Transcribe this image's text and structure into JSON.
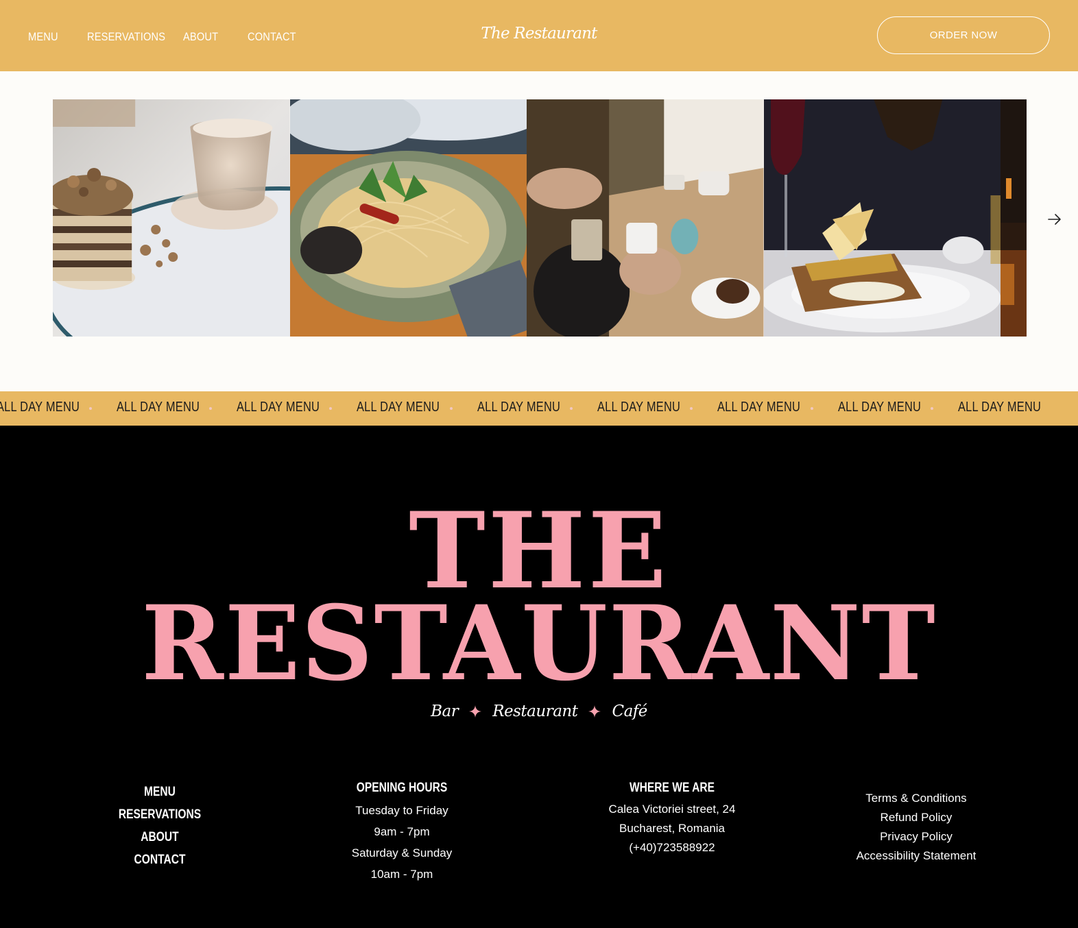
{
  "header": {
    "nav": [
      "MENU",
      "RESERVATIONS",
      "ABOUT",
      "CONTACT"
    ],
    "logo": "The Restaurant",
    "order_button": "ORDER NOW"
  },
  "gallery": {
    "slides": [
      "pancakes-coffee-photo",
      "spaghetti-bowl-photo",
      "coffee-date-photo",
      "gourmet-dish-wine-photo",
      "restaurant-interior-photo"
    ],
    "next_icon": "arrow-right-icon"
  },
  "marquee": {
    "items": [
      "ALL DAY MENU",
      "ALL DAY MENU",
      "ALL DAY MENU",
      "ALL DAY MENU",
      "ALL DAY MENU",
      "ALL DAY MENU",
      "ALL DAY MENU",
      "ALL DAY MENU",
      "ALL DAY MENU"
    ]
  },
  "footer": {
    "title_line1": "THE",
    "title_line2": "RESTAURANT",
    "tagline": [
      "Bar",
      "Restaurant",
      "Café"
    ],
    "menu": [
      "MENU",
      "RESERVATIONS",
      "ABOUT",
      "CONTACT"
    ],
    "hours": {
      "title": "OPENING HOURS",
      "lines": [
        "Tuesday to Friday",
        "9am - 7pm",
        "Saturday & Sunday",
        "10am - 7pm"
      ]
    },
    "where": {
      "title": "WHERE WE ARE",
      "lines": [
        "Calea Victoriei street, 24",
        "Bucharest, Romania",
        "(+40)723588922"
      ]
    },
    "legal": [
      "Terms & Conditions",
      "Refund Policy",
      "Privacy Policy",
      "Accessibility Statement"
    ]
  },
  "colors": {
    "accent": "#E8B862",
    "pink": "#F7A1AE",
    "footer_bg": "#000000",
    "gallery_bg": "#FDFCF9"
  }
}
